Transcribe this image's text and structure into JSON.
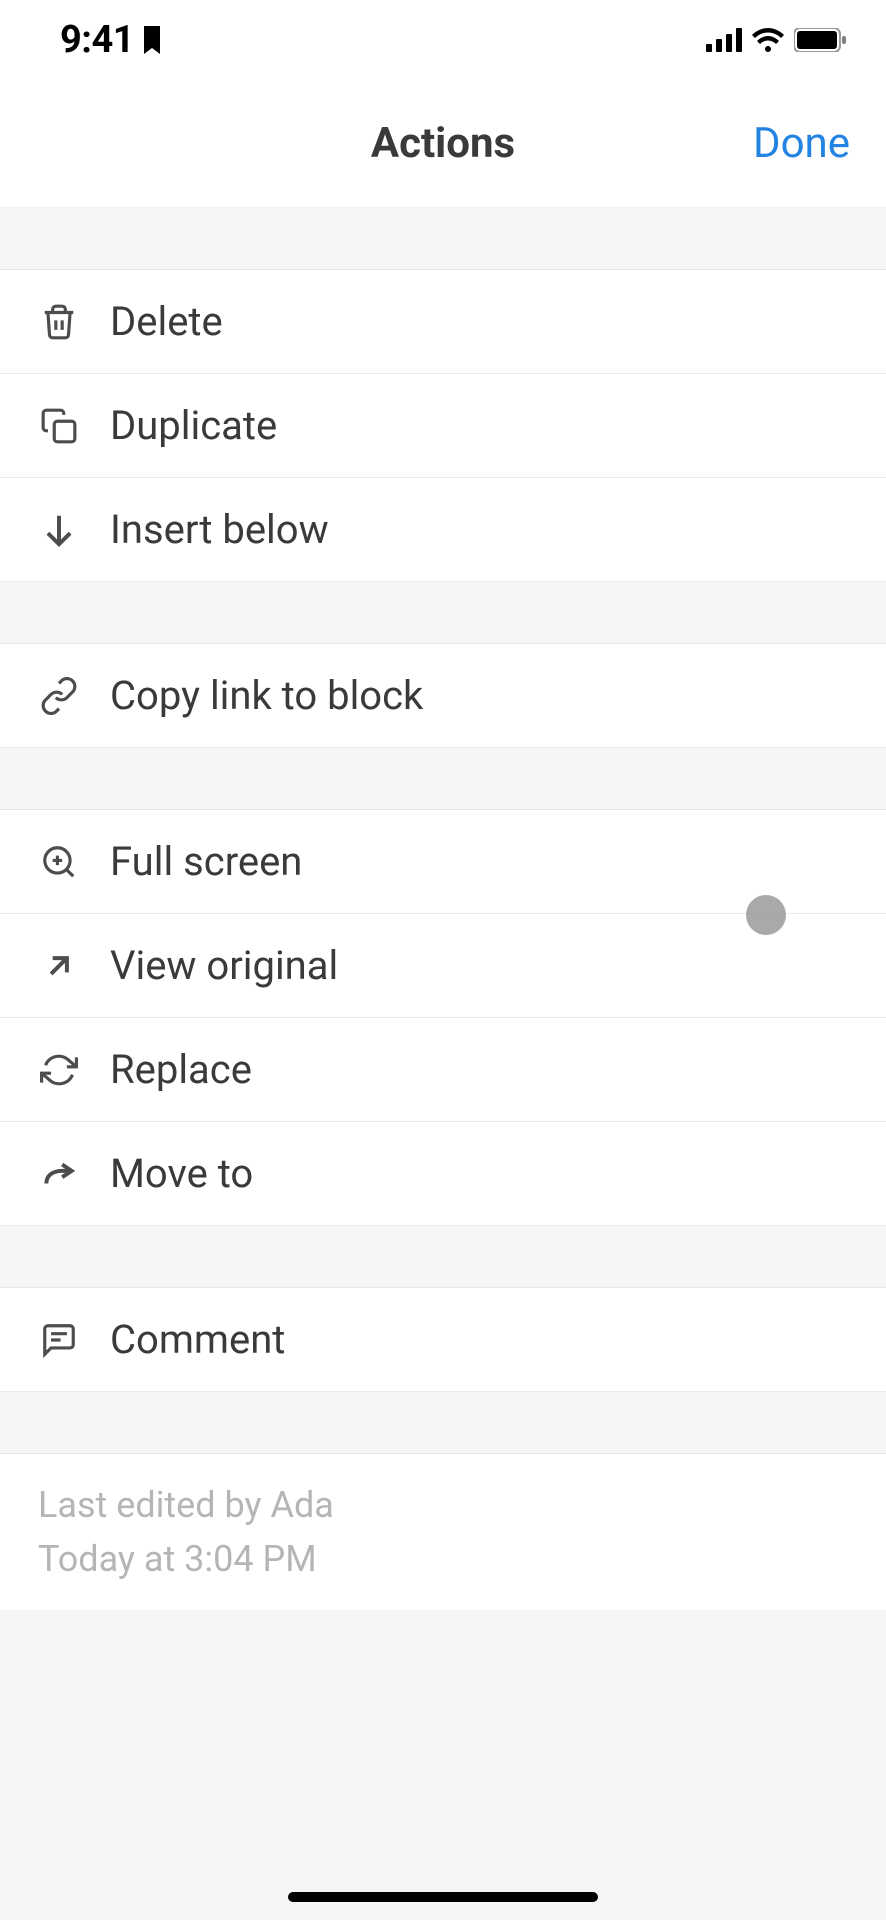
{
  "status": {
    "time": "9:41"
  },
  "nav": {
    "title": "Actions",
    "done": "Done"
  },
  "actions": {
    "group1": [
      {
        "label": "Delete"
      },
      {
        "label": "Duplicate"
      },
      {
        "label": "Insert below"
      }
    ],
    "group2": [
      {
        "label": "Copy link to block"
      }
    ],
    "group3": [
      {
        "label": "Full screen"
      },
      {
        "label": "View original"
      },
      {
        "label": "Replace"
      },
      {
        "label": "Move to"
      }
    ],
    "group4": [
      {
        "label": "Comment"
      }
    ]
  },
  "meta": {
    "editedBy": "Last edited by Ada",
    "editedAt": "Today at 3:04 PM"
  }
}
